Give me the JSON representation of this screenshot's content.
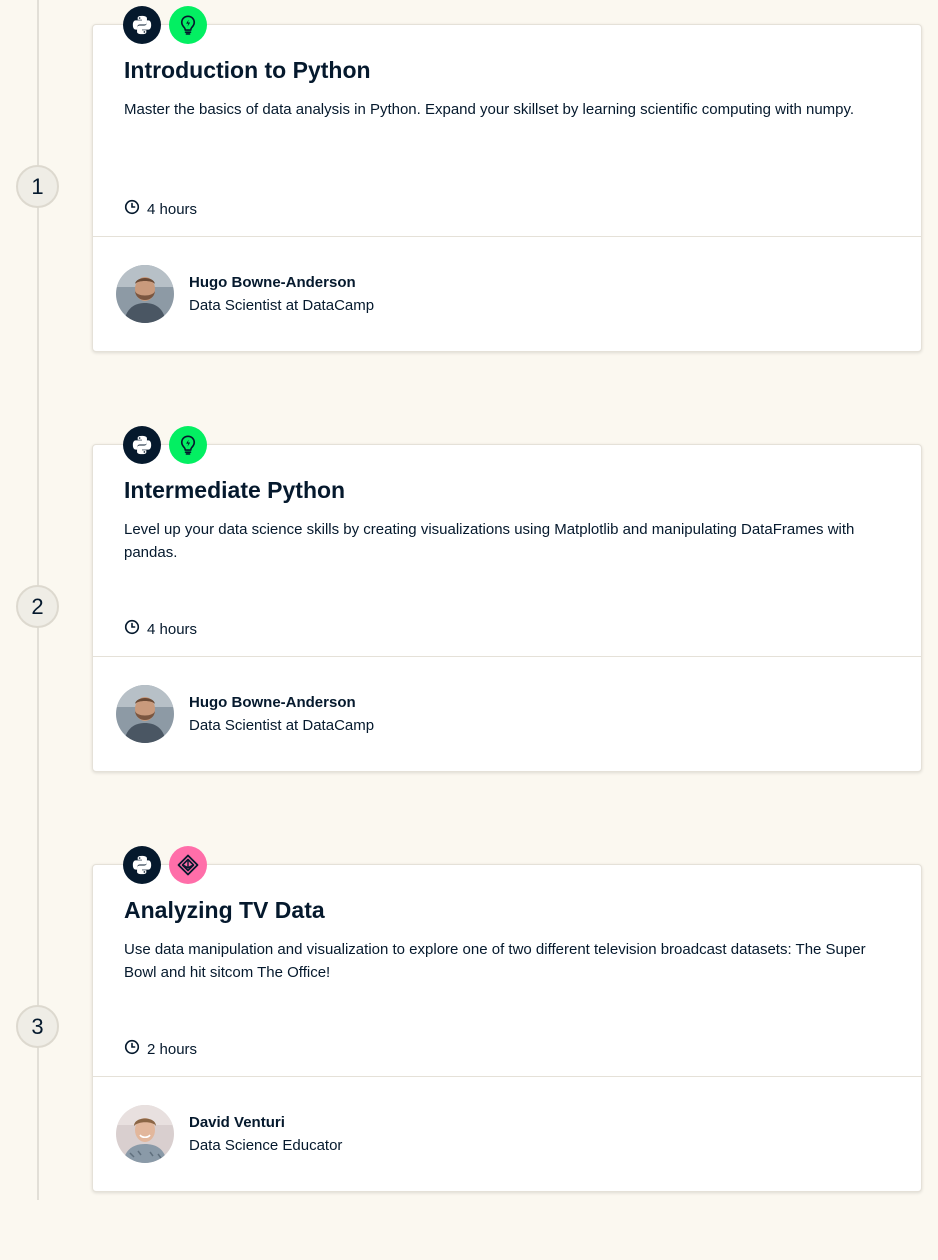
{
  "courses": [
    {
      "number": "1",
      "title": "Introduction to Python",
      "description": "Master the basics of data analysis in Python. Expand your skillset by learning scientific computing with numpy.",
      "duration": "4 hours",
      "technology_icon": "python-icon",
      "type_icon": "lightbulb-icon",
      "type_color": "#03ef62",
      "instructor": {
        "name": "Hugo Bowne-Anderson",
        "role": "Data Scientist at DataCamp"
      }
    },
    {
      "number": "2",
      "title": "Intermediate Python",
      "description": "Level up your data science skills by creating visualizations using Matplotlib and manipulating DataFrames with pandas.",
      "duration": "4 hours",
      "technology_icon": "python-icon",
      "type_icon": "lightbulb-icon",
      "type_color": "#03ef62",
      "instructor": {
        "name": "Hugo Bowne-Anderson",
        "role": "Data Scientist at DataCamp"
      }
    },
    {
      "number": "3",
      "title": "Analyzing TV Data",
      "description": "Use data manipulation and visualization to explore one of two different television broadcast datasets: The Super Bowl and hit sitcom The Office!",
      "duration": "2 hours",
      "technology_icon": "python-icon",
      "type_icon": "project-layers-icon",
      "type_color": "#ff6ea9",
      "instructor": {
        "name": "David Venturi",
        "role": "Data Science Educator"
      }
    }
  ],
  "colors": {
    "background": "#fbf8f0",
    "navy": "#05192d",
    "green": "#03ef62",
    "pink": "#ff6ea9"
  }
}
